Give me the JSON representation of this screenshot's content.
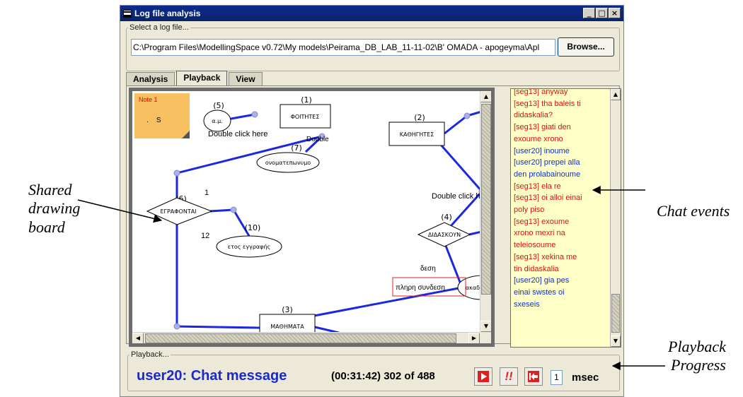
{
  "window": {
    "title": "Log file analysis",
    "controls": [
      "_",
      "□",
      "×"
    ]
  },
  "file_select": {
    "legend": "Select a log file...",
    "path": "C:\\Program Files\\ModellingSpace v0.72\\My models\\Peirama_DB_LAB_11-11-02\\B' OMADA - apogeyma\\Apl",
    "browse_label": "Browse..."
  },
  "tabs": [
    {
      "label": "Analysis",
      "active": false
    },
    {
      "label": "Playback",
      "active": true
    },
    {
      "label": "View",
      "active": false
    }
  ],
  "board": {
    "note_label": "Note 1",
    "note_chars": ".    S",
    "entities": [
      {
        "num": "(1)",
        "label": "ΦΟΙΤΗΤΕΣ"
      },
      {
        "num": "(2)",
        "label": "ΚΑΘΗΓΗΤΕΣ"
      },
      {
        "num": "(3)",
        "label": "ΜΑΘΗΜΑΤΑ"
      }
    ],
    "relationships": [
      {
        "num": "(6)",
        "label": "ΕΓΡΑΦΟΝΤΑΙ"
      },
      {
        "num": "(4)",
        "label": "ΔΙΔΑΣΚΟΥΝ"
      }
    ],
    "attributes": [
      {
        "num": "(5)",
        "label": "α.μ."
      },
      {
        "num": "(7)",
        "label": "ονοματεπωνυμο"
      },
      {
        "num": "(10)",
        "label": "ετος εγγραφής"
      },
      {
        "num": "",
        "label": "ακαδημ"
      }
    ],
    "texts": {
      "dbl1": "Double click here",
      "dbl2": "Double",
      "dbl3": "Double click h",
      "one": "1",
      "twelve": "12",
      "misc1": "δεση",
      "misc2": "πληρη  συνδεση"
    }
  },
  "chat": {
    "lines": [
      {
        "text": "[seg13] anyway",
        "who": "seg"
      },
      {
        "text": "[seg13] tha baleis ti",
        "who": "seg"
      },
      {
        "text": "didaskalia?",
        "who": "seg"
      },
      {
        "text": "[seg13] giati den",
        "who": "seg"
      },
      {
        "text": "exoume xrono",
        "who": "seg"
      },
      {
        "text": "[user20] inoume",
        "who": "user"
      },
      {
        "text": "[user20] prepei alla",
        "who": "user"
      },
      {
        "text": "den prolabainoume",
        "who": "user"
      },
      {
        "text": "[seg13] ela re",
        "who": "seg"
      },
      {
        "text": "[seg13] oi alloi einai",
        "who": "seg"
      },
      {
        "text": "poly piso",
        "who": "seg"
      },
      {
        "text": "[seg13] exoume",
        "who": "seg"
      },
      {
        "text": "xrono mexri na",
        "who": "seg"
      },
      {
        "text": "teleiosoume",
        "who": "seg"
      },
      {
        "text": "[seg13] xekina me",
        "who": "seg"
      },
      {
        "text": "tin didaskalia",
        "who": "seg"
      },
      {
        "text": "[user20] gia pes",
        "who": "user"
      },
      {
        "text": "einai swstes oi",
        "who": "user"
      },
      {
        "text": "sxeseis",
        "who": "user"
      }
    ]
  },
  "playback": {
    "legend": "Playback...",
    "event": "user20: Chat message",
    "progress": "(00:31:42) 302 of 488",
    "speed": "1",
    "unit": "msec"
  },
  "annotations": {
    "shared_board": [
      "Shared",
      "drawing",
      "board"
    ],
    "chat_events": "Chat events",
    "playback_progress": [
      "Playback",
      "Progress"
    ]
  },
  "colors": {
    "link": "#1a28e0",
    "chat_seg": "#e01010",
    "chat_user": "#1030c8",
    "chat_bg": "#ffffc8",
    "note_bg": "#f8c060"
  }
}
